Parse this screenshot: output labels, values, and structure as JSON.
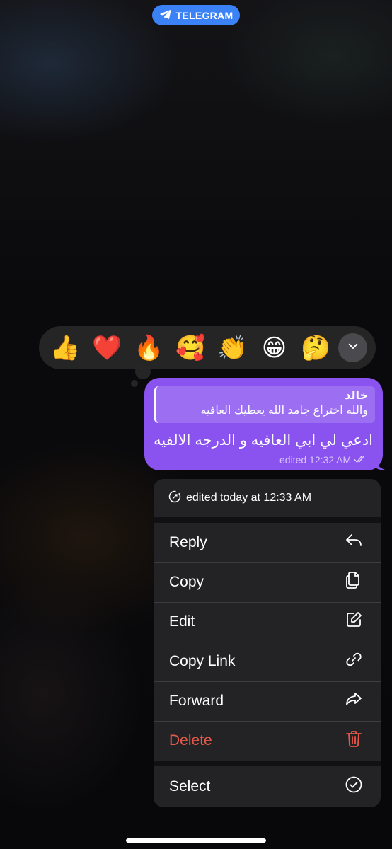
{
  "header": {
    "app_label": "TELEGRAM"
  },
  "reactions": {
    "items": [
      {
        "emoji": "👍",
        "name": "thumbs-up"
      },
      {
        "emoji": "❤️",
        "name": "heart"
      },
      {
        "emoji": "🔥",
        "name": "fire"
      },
      {
        "emoji": "🥰",
        "name": "smiling-face-with-hearts"
      },
      {
        "emoji": "👏",
        "name": "clapping-hands"
      },
      {
        "emoji": "😁",
        "name": "beaming-face"
      },
      {
        "emoji": "🤔",
        "name": "thinking-face"
      }
    ],
    "expand_icon": "chevron-down-icon"
  },
  "message": {
    "reply_author": "خالد",
    "reply_text": "والله اختراع جامد الله يعطيك العافيه",
    "text": "ادعي لي ابي العافيه و الدرجه الالفيه",
    "meta": "edited 12:32 AM",
    "status_icon": "double-check-icon",
    "bubble_color": "#8a53f0"
  },
  "menu": {
    "edited_info": "edited today at 12:33 AM",
    "items": [
      {
        "label": "Reply",
        "icon": "reply-icon"
      },
      {
        "label": "Copy",
        "icon": "copy-icon"
      },
      {
        "label": "Edit",
        "icon": "edit-icon"
      },
      {
        "label": "Copy Link",
        "icon": "link-icon"
      },
      {
        "label": "Forward",
        "icon": "forward-icon"
      },
      {
        "label": "Delete",
        "icon": "trash-icon",
        "color": "#e5584a"
      }
    ],
    "select": {
      "label": "Select",
      "icon": "check-circle-icon"
    }
  }
}
